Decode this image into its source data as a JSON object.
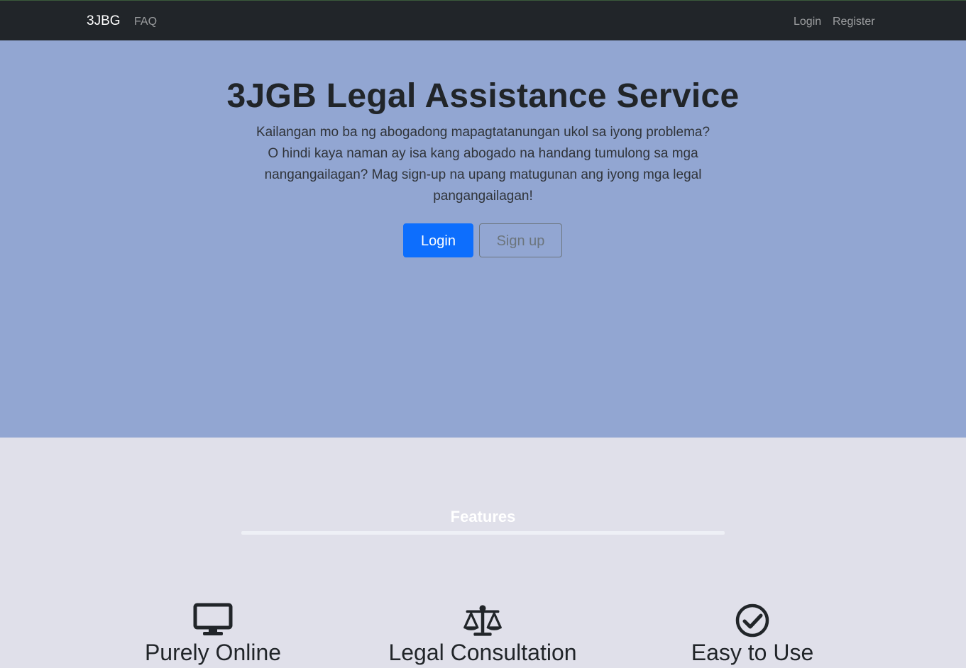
{
  "navbar": {
    "brand": "3JBG",
    "faq": "FAQ",
    "login": "Login",
    "register": "Register"
  },
  "hero": {
    "title": "3JGB Legal Assistance Service",
    "lead": "Kailangan mo ba ng abogadong mapagtatanungan ukol sa iyong problema? O hindi kaya naman ay isa kang abogado na handang tumulong sa mga nangangailagan? Mag sign-up na upang matugunan ang iyong mga legal pangangailagan!",
    "login_button": "Login",
    "signup_button": "Sign up"
  },
  "features": {
    "heading": "Features",
    "items": [
      {
        "title": "Purely Online",
        "icon": "monitor-icon"
      },
      {
        "title": "Legal Consultation",
        "icon": "scale-icon"
      },
      {
        "title": "Easy to Use",
        "icon": "check-circle-icon"
      }
    ]
  },
  "colors": {
    "navbar_bg": "#212529",
    "hero_bg": "#92a6d2",
    "page_bg": "#e0e0ea",
    "primary": "#0d6efd",
    "secondary": "#6c757d"
  }
}
